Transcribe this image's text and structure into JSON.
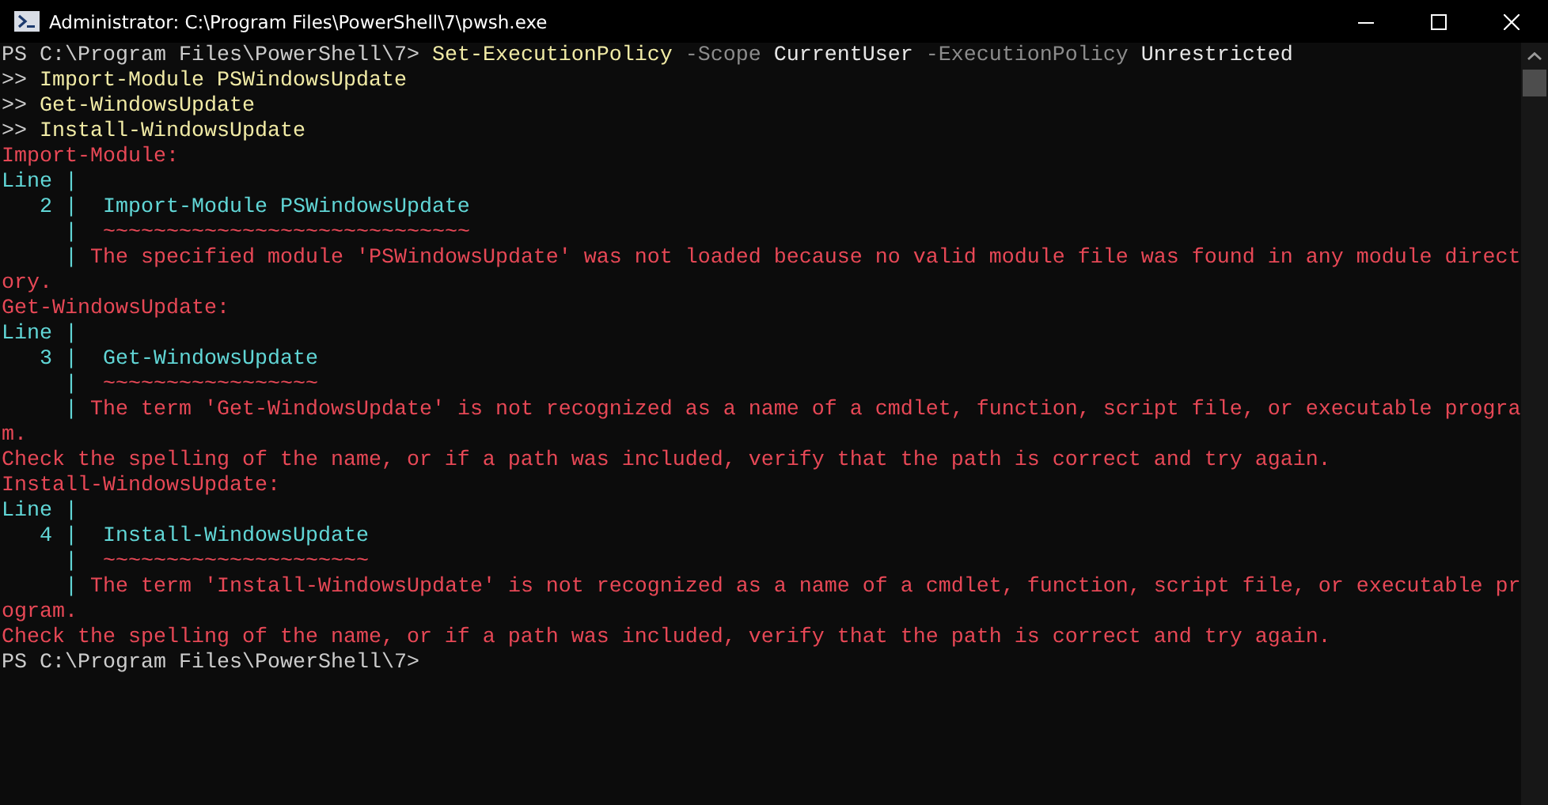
{
  "window": {
    "title": "Administrator: C:\\Program Files\\PowerShell\\7\\pwsh.exe"
  },
  "console_lines": [
    [
      {
        "kind": "prompt",
        "text": "PS C:\\Program Files\\PowerShell\\7> "
      },
      {
        "kind": "command",
        "text": "Set-ExecutionPolicy"
      },
      {
        "kind": "parameter",
        "text": " -Scope"
      },
      {
        "kind": "argument",
        "text": " CurrentUser"
      },
      {
        "kind": "parameter",
        "text": " -ExecutionPolicy"
      },
      {
        "kind": "argument",
        "text": " Unrestricted"
      }
    ],
    [
      {
        "kind": "prompt",
        "text": ">> "
      },
      {
        "kind": "command",
        "text": "Import-Module PSWindowsUpdate"
      }
    ],
    [
      {
        "kind": "prompt",
        "text": ">> "
      },
      {
        "kind": "command",
        "text": "Get-WindowsUpdate"
      }
    ],
    [
      {
        "kind": "prompt",
        "text": ">> "
      },
      {
        "kind": "command",
        "text": "Install-WindowsUpdate"
      }
    ],
    [
      {
        "kind": "error",
        "text": "Import-Module:"
      }
    ],
    [
      {
        "kind": "accent",
        "text": "Line |"
      }
    ],
    [
      {
        "kind": "accent",
        "text": "   2 |  Import-Module PSWindowsUpdate"
      }
    ],
    [
      {
        "kind": "accent",
        "text": "     |  "
      },
      {
        "kind": "error",
        "text": "~~~~~~~~~~~~~~~~~~~~~~~~~~~~~"
      }
    ],
    [
      {
        "kind": "accent",
        "text": "     | "
      },
      {
        "kind": "error",
        "text": "The specified module 'PSWindowsUpdate' was not loaded because no valid module file was found in any module direct"
      }
    ],
    [
      {
        "kind": "error",
        "text": "ory."
      }
    ],
    [
      {
        "kind": "error",
        "text": "Get-WindowsUpdate:"
      }
    ],
    [
      {
        "kind": "accent",
        "text": "Line |"
      }
    ],
    [
      {
        "kind": "accent",
        "text": "   3 |  Get-WindowsUpdate"
      }
    ],
    [
      {
        "kind": "accent",
        "text": "     |  "
      },
      {
        "kind": "error",
        "text": "~~~~~~~~~~~~~~~~~"
      }
    ],
    [
      {
        "kind": "accent",
        "text": "     | "
      },
      {
        "kind": "error",
        "text": "The term 'Get-WindowsUpdate' is not recognized as a name of a cmdlet, function, script file, or executable progra"
      }
    ],
    [
      {
        "kind": "error",
        "text": "m."
      }
    ],
    [
      {
        "kind": "error",
        "text": "Check the spelling of the name, or if a path was included, verify that the path is correct and try again."
      }
    ],
    [
      {
        "kind": "error",
        "text": "Install-WindowsUpdate:"
      }
    ],
    [
      {
        "kind": "accent",
        "text": "Line |"
      }
    ],
    [
      {
        "kind": "accent",
        "text": "   4 |  Install-WindowsUpdate"
      }
    ],
    [
      {
        "kind": "accent",
        "text": "     |  "
      },
      {
        "kind": "error",
        "text": "~~~~~~~~~~~~~~~~~~~~~"
      }
    ],
    [
      {
        "kind": "accent",
        "text": "     | "
      },
      {
        "kind": "error",
        "text": "The term 'Install-WindowsUpdate' is not recognized as a name of a cmdlet, function, script file, or executable pr"
      }
    ],
    [
      {
        "kind": "error",
        "text": "ogram."
      }
    ],
    [
      {
        "kind": "error",
        "text": "Check the spelling of the name, or if a path was included, verify that the path is correct and try again."
      }
    ],
    [
      {
        "kind": "prompt",
        "text": "PS C:\\Program Files\\PowerShell\\7>"
      }
    ]
  ]
}
